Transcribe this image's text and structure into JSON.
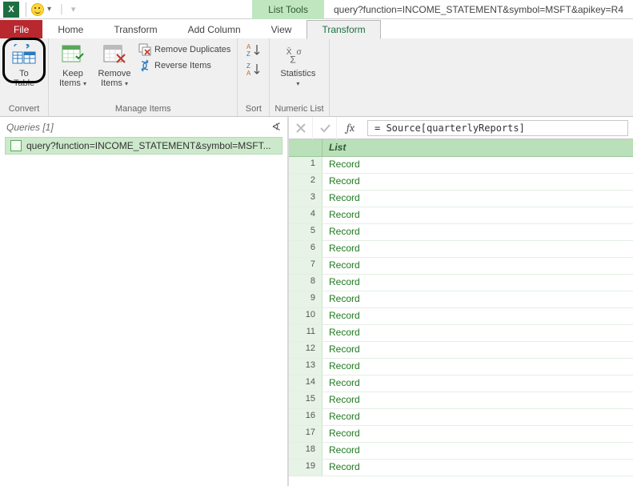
{
  "titlebar": {
    "contextual_label": "List Tools",
    "title": "query?function=INCOME_STATEMENT&symbol=MSFT&apikey=R4"
  },
  "tabs": {
    "file": "File",
    "home": "Home",
    "transform": "Transform",
    "add_column": "Add Column",
    "view": "View",
    "transform_ctx": "Transform"
  },
  "ribbon": {
    "convert": {
      "to_table": "To\nTable",
      "group_label": "Convert"
    },
    "manage": {
      "keep_items": "Keep\nItems",
      "remove_items": "Remove\nItems",
      "remove_duplicates": "Remove Duplicates",
      "reverse_items": "Reverse Items",
      "group_label": "Manage Items"
    },
    "sort": {
      "group_label": "Sort"
    },
    "numeric": {
      "statistics": "Statistics",
      "group_label": "Numeric List"
    }
  },
  "queries": {
    "header": "Queries [1]",
    "item": "query?function=INCOME_STATEMENT&symbol=MSFT..."
  },
  "formula_bar": {
    "fx_label": "fx",
    "formula": "= Source[quarterlyReports]"
  },
  "grid": {
    "column_header": "List",
    "rows": [
      {
        "n": "1",
        "v": "Record"
      },
      {
        "n": "2",
        "v": "Record"
      },
      {
        "n": "3",
        "v": "Record"
      },
      {
        "n": "4",
        "v": "Record"
      },
      {
        "n": "5",
        "v": "Record"
      },
      {
        "n": "6",
        "v": "Record"
      },
      {
        "n": "7",
        "v": "Record"
      },
      {
        "n": "8",
        "v": "Record"
      },
      {
        "n": "9",
        "v": "Record"
      },
      {
        "n": "10",
        "v": "Record"
      },
      {
        "n": "11",
        "v": "Record"
      },
      {
        "n": "12",
        "v": "Record"
      },
      {
        "n": "13",
        "v": "Record"
      },
      {
        "n": "14",
        "v": "Record"
      },
      {
        "n": "15",
        "v": "Record"
      },
      {
        "n": "16",
        "v": "Record"
      },
      {
        "n": "17",
        "v": "Record"
      },
      {
        "n": "18",
        "v": "Record"
      },
      {
        "n": "19",
        "v": "Record"
      }
    ]
  }
}
